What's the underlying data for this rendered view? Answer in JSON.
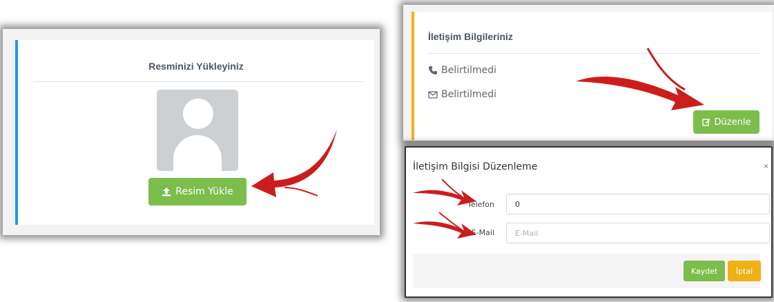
{
  "upload_panel": {
    "title": "Resminizi Yükleyiniz",
    "upload_button": "Resim Yükle",
    "accent_color": "#1f9bde"
  },
  "contact_panel": {
    "title": "İletişim Bilgileriniz",
    "phone_value": "Belirtilmedi",
    "email_value": "Belirtilmedi",
    "edit_button": "Düzenle",
    "accent_color": "#f0b114"
  },
  "edit_modal": {
    "title": "İletişim Bilgisi Düzenleme",
    "close": "×",
    "phone_label": "Telefon",
    "phone_value": "0",
    "email_label": "E-Mail",
    "email_placeholder": "E-Mail",
    "save_button": "Kaydet",
    "cancel_button": "İptal"
  },
  "icons": [
    "upload-icon",
    "phone-icon",
    "envelope-icon",
    "edit-icon",
    "close-icon",
    "user-avatar-placeholder"
  ],
  "colors": {
    "green_button": "#7cbd4c",
    "orange_button": "#f0b114",
    "arrow_red": "#cc1d1d"
  }
}
